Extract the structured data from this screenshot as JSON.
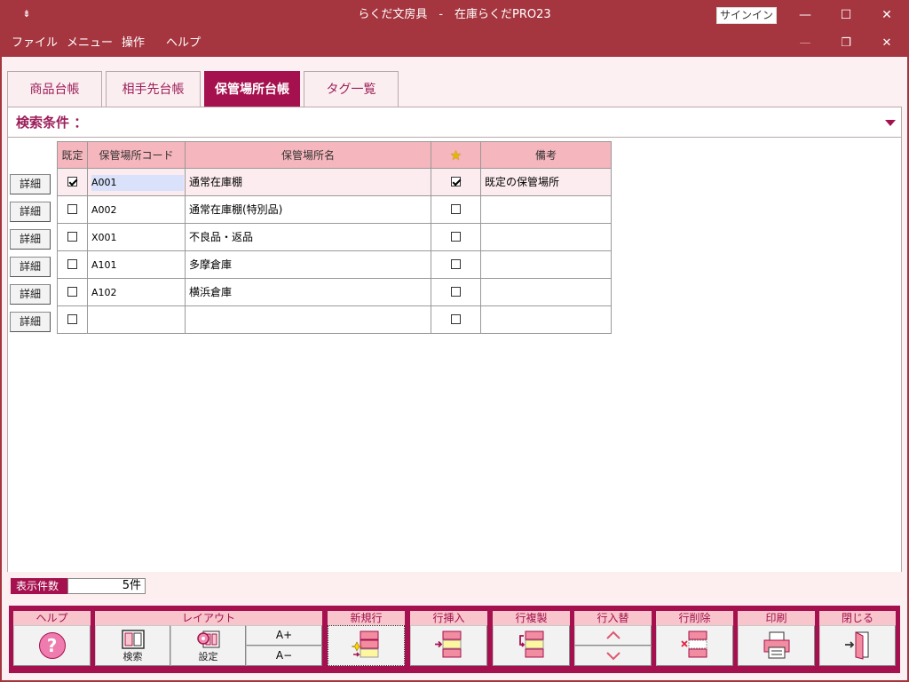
{
  "window": {
    "title": "らくだ文房具　-　在庫らくだPRO23",
    "signin": "サインイン",
    "sysmenu_glyph": "⇟",
    "minimize_glyph": "—",
    "maximize_glyph": "☐",
    "close_glyph": "✕",
    "mdi_min_glyph": "—",
    "mdi_restore_glyph": "❐",
    "mdi_close_glyph": "✕"
  },
  "menu": [
    "ファイル",
    "メニュー",
    "操作",
    "ヘルプ"
  ],
  "tabs": [
    {
      "label": "商品台帳",
      "active": false
    },
    {
      "label": "相手先台帳",
      "active": false
    },
    {
      "label": "保管場所台帳",
      "active": true
    },
    {
      "label": "タグ一覧",
      "active": false
    }
  ],
  "search": {
    "label": "検索条件 ："
  },
  "grid": {
    "headers": {
      "default": "既定",
      "code": "保管場所コード",
      "name": "保管場所名",
      "star": "★",
      "note": "備考"
    },
    "detail_label": "詳細",
    "rows": [
      {
        "default": true,
        "code": "A001",
        "name": "通常在庫棚",
        "star": true,
        "note": "既定の保管場所"
      },
      {
        "default": false,
        "code": "A002",
        "name": "通常在庫棚(特別品)",
        "star": false,
        "note": ""
      },
      {
        "default": false,
        "code": "X001",
        "name": "不良品・返品",
        "star": false,
        "note": ""
      },
      {
        "default": false,
        "code": "A101",
        "name": "多摩倉庫",
        "star": false,
        "note": ""
      },
      {
        "default": false,
        "code": "A102",
        "name": "横浜倉庫",
        "star": false,
        "note": ""
      },
      {
        "default": false,
        "code": "",
        "name": "",
        "star": false,
        "note": ""
      }
    ]
  },
  "status": {
    "count_label": "表示件数",
    "count_value": "5件"
  },
  "toolbar": {
    "help": "ヘルプ",
    "help_glyph": "?",
    "layout": "レイアウト",
    "layout_search": "検索",
    "layout_settings": "設定",
    "font_up": "A+",
    "font_down": "A−",
    "new_row": "新規行",
    "insert_row": "行挿入",
    "copy_row": "行複製",
    "swap_row": "行入替",
    "delete_row": "行削除",
    "print": "印刷",
    "close": "閉じる"
  }
}
